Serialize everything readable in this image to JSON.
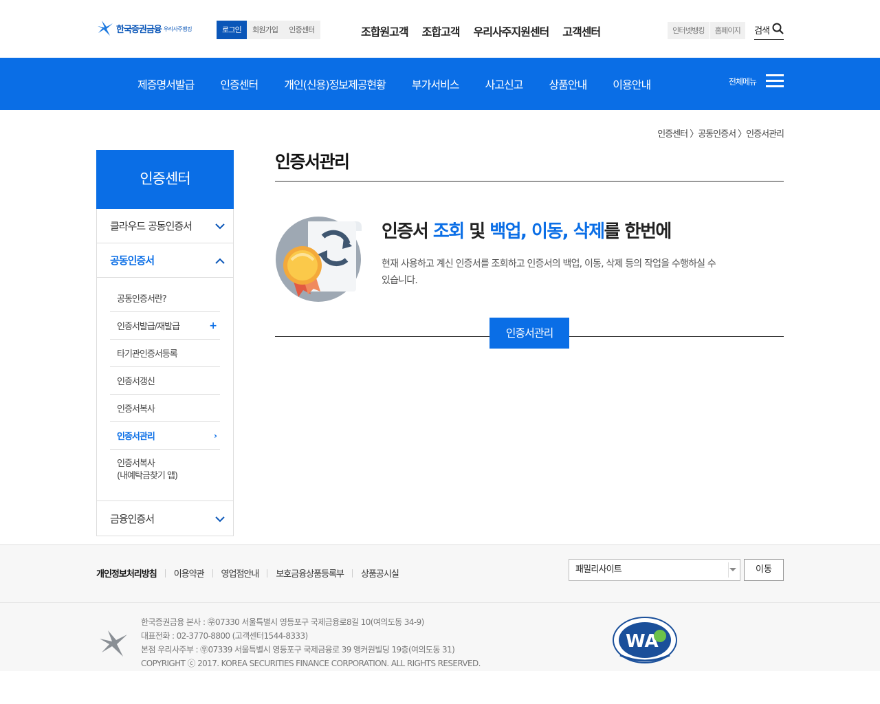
{
  "header": {
    "logo_text": "한국증권금융",
    "logo_sub": "우리사주뱅킹",
    "util": [
      "로그인",
      "회원가입",
      "인증센터"
    ],
    "gnb": [
      "조합원고객",
      "조합고객",
      "우리사주지원센터",
      "고객센터"
    ],
    "right_util": [
      "인터넷뱅킹",
      "홈페이지"
    ],
    "search_label": "검색"
  },
  "nav": {
    "items": [
      "제증명서발급",
      "인증센터",
      "개인(신용)정보제공현황",
      "부가서비스",
      "사고신고",
      "상품안내",
      "이용안내"
    ],
    "all_menu": "전체메뉴"
  },
  "breadcrumb": "인증센터 〉공동인증서 〉인증서관리",
  "lnb": {
    "title": "인증센터",
    "items": [
      {
        "label": "클라우드 공동인증서"
      },
      {
        "label": "공동인증서"
      },
      {
        "label": "금융인증서"
      }
    ],
    "sub_items": [
      {
        "label": "공동인증서란?"
      },
      {
        "label": "인증서발급/재발급",
        "marker": "+"
      },
      {
        "label": "타기관인증서등록"
      },
      {
        "label": "인증서갱신"
      },
      {
        "label": "인증서복사"
      },
      {
        "label": "인증서관리",
        "marker": "›"
      },
      {
        "label": "인증서복사\n(내예탁금찾기 앱)"
      }
    ]
  },
  "main": {
    "title": "인증서관리",
    "hero_head": {
      "p1": "인증서 ",
      "b1": "조회",
      "p2": " 및 ",
      "b2": "백업, 이동, 삭제",
      "p3": "를 한번에"
    },
    "hero_desc": "현재 사용하고 계신 인증서를 조회하고 인증서의 백업, 이동, 삭제 등의 작업을 수행하실 수 있습니다.",
    "button": "인증서관리"
  },
  "footer": {
    "links": [
      "개인정보처리방침",
      "이용약관",
      "영업점안내",
      "보호금융상품등록부",
      "상품공시실"
    ],
    "family_site": "패밀리사이트",
    "go_button": "이동",
    "address": [
      "한국증권금융 본사 : ㉾07330 서울특별시 영등포구 국제금융로8길 10(여의도동 34-9)",
      "대표전화 : 02-3770-8800 (고객센터1544-8333)",
      "본점 우리사주부 : ㉾07339 서울특별시 영등포구 국제금융로 39 앵커원빌딩 19층(여의도동 31)",
      "COPYRIGHT ⓒ 2017. KOREA SECURITIES FINANCE CORPORATION. ALL RIGHTS RESERVED."
    ],
    "wa_badge": "WA WEB ACCESSIBILITY"
  },
  "colors": {
    "primary": "#0a6ee6",
    "logo": "#0a56b8"
  }
}
